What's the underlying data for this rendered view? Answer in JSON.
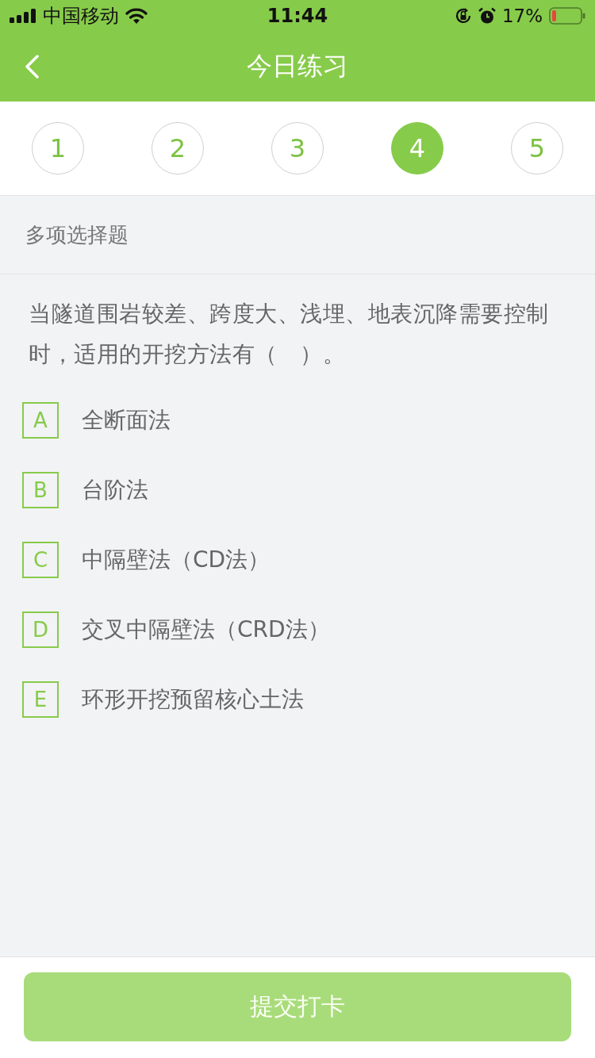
{
  "status_bar": {
    "carrier": "中国移动",
    "time": "11:44",
    "battery_text": "17%"
  },
  "nav_bar": {
    "title": "今日练习"
  },
  "question_tabs": [
    {
      "label": "1",
      "selected": false
    },
    {
      "label": "2",
      "selected": false
    },
    {
      "label": "3",
      "selected": false
    },
    {
      "label": "4",
      "selected": true
    },
    {
      "label": "5",
      "selected": false
    }
  ],
  "question": {
    "type_label": "多项选择题",
    "text": "当隧道围岩较差、跨度大、浅埋、地表沉降需要控制时，适用的开挖方法有（　）。",
    "options": [
      {
        "letter": "A",
        "text": "全断面法",
        "selected": false
      },
      {
        "letter": "B",
        "text": "台阶法",
        "selected": false
      },
      {
        "letter": "C",
        "text": "中隔壁法（CD法）",
        "selected": false
      },
      {
        "letter": "D",
        "text": "交叉中隔壁法（CRD法）",
        "selected": false
      },
      {
        "letter": "E",
        "text": "环形开挖预留核心土法",
        "selected": false
      }
    ]
  },
  "submit_button": {
    "label": "提交打卡",
    "disabled": true
  }
}
